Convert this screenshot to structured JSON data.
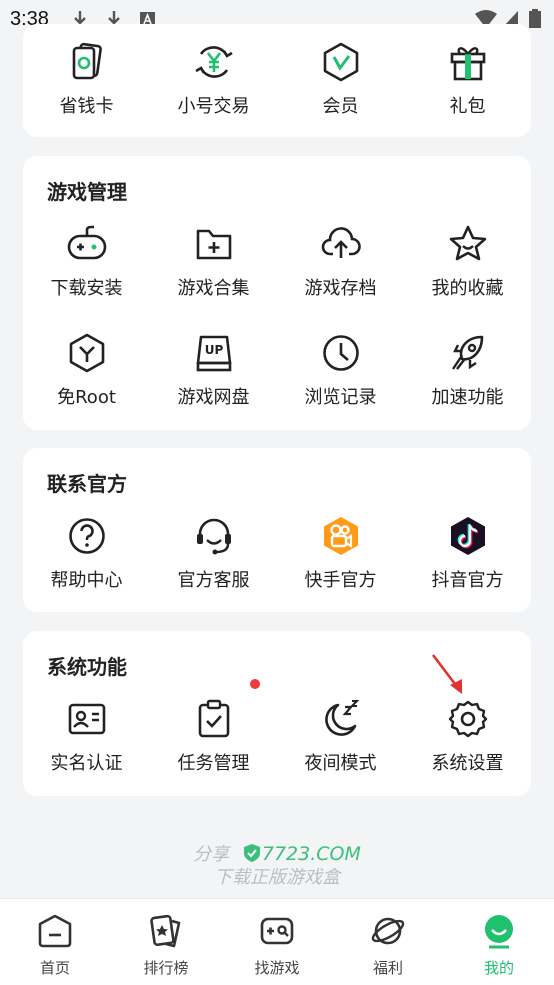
{
  "status_bar": {
    "time": "3:38"
  },
  "top_row": [
    {
      "label": "省钱卡",
      "icon": "savings-card-icon"
    },
    {
      "label": "小号交易",
      "icon": "yuan-exchange-icon"
    },
    {
      "label": "会员",
      "icon": "vip-badge-icon"
    },
    {
      "label": "礼包",
      "icon": "gift-icon"
    }
  ],
  "game_management": {
    "title": "游戏管理",
    "items": [
      {
        "label": "下载安装",
        "icon": "gamepad-icon"
      },
      {
        "label": "游戏合集",
        "icon": "folder-plus-icon"
      },
      {
        "label": "游戏存档",
        "icon": "cloud-upload-icon"
      },
      {
        "label": "我的收藏",
        "icon": "star-icon"
      },
      {
        "label": "免Root",
        "icon": "hexagon-y-icon"
      },
      {
        "label": "游戏网盘",
        "icon": "up-disk-icon"
      },
      {
        "label": "浏览记录",
        "icon": "clock-icon"
      },
      {
        "label": "加速功能",
        "icon": "rocket-icon"
      }
    ]
  },
  "contact": {
    "title": "联系官方",
    "items": [
      {
        "label": "帮助中心",
        "icon": "help-icon"
      },
      {
        "label": "官方客服",
        "icon": "headset-icon"
      },
      {
        "label": "快手官方",
        "icon": "kuaishou-icon"
      },
      {
        "label": "抖音官方",
        "icon": "douyin-icon"
      }
    ]
  },
  "system": {
    "title": "系统功能",
    "items": [
      {
        "label": "实名认证",
        "icon": "id-card-icon"
      },
      {
        "label": "任务管理",
        "icon": "clipboard-check-icon"
      },
      {
        "label": "夜间模式",
        "icon": "moon-icon"
      },
      {
        "label": "系统设置",
        "icon": "gear-icon"
      }
    ]
  },
  "watermark": {
    "share": "分享",
    "brand": "7723.COM",
    "tagline": "下载正版游戏盒"
  },
  "tabbar": [
    {
      "label": "首页",
      "icon": "home-icon"
    },
    {
      "label": "排行榜",
      "icon": "ranking-icon"
    },
    {
      "label": "找游戏",
      "icon": "find-game-icon"
    },
    {
      "label": "福利",
      "icon": "planet-icon"
    },
    {
      "label": "我的",
      "icon": "profile-icon",
      "active": true
    }
  ],
  "colors": {
    "accent": "#20c06f",
    "notice_dot": "#ef3b3b",
    "arrow": "#e0332f"
  }
}
